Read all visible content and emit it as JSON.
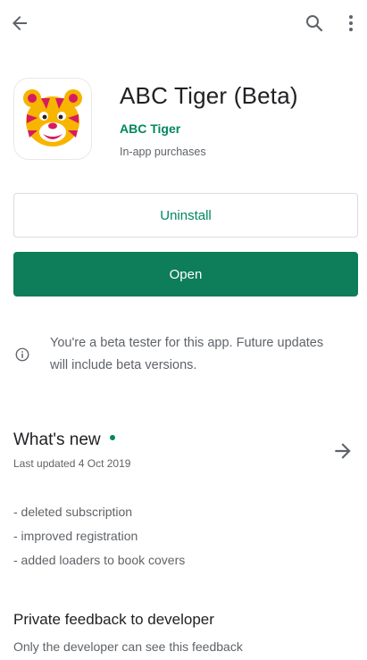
{
  "app": {
    "title": "ABC Tiger (Beta)",
    "developer": "ABC Tiger",
    "purchases_note": "In-app purchases"
  },
  "actions": {
    "uninstall_label": "Uninstall",
    "open_label": "Open"
  },
  "beta": {
    "note": "You're a beta tester for this app. Future updates will include beta versions."
  },
  "whats_new": {
    "title": "What's new",
    "updated": "Last updated 4 Oct 2019",
    "changes": [
      "- deleted subscription",
      "- improved registration",
      "- added loaders to book covers"
    ]
  },
  "feedback": {
    "title": "Private feedback to developer",
    "subtitle": "Only the developer can see this feedback"
  },
  "colors": {
    "accent": "#01875f",
    "primary_button": "#0e7d5a",
    "secondary_text": "#5f6368"
  },
  "icons": {
    "back": "arrow-left-icon",
    "search": "search-icon",
    "more": "more-vert-icon",
    "info": "info-icon",
    "forward": "arrow-right-icon"
  }
}
